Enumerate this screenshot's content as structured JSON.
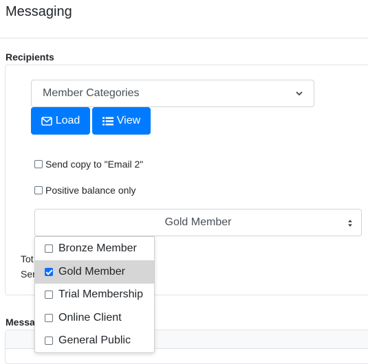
{
  "page": {
    "title": "Messaging"
  },
  "recipients": {
    "label": "Recipients",
    "category_select": {
      "value": "Member Categories"
    },
    "load_button": {
      "label": "Load",
      "icon": "envelope-icon"
    },
    "view_button": {
      "label": "View",
      "icon": "list-icon"
    },
    "send_copy": {
      "label": "Send copy to \"Email 2\"",
      "checked": false
    },
    "positive_balance": {
      "label": "Positive balance only",
      "checked": false
    },
    "member_select": {
      "value": "Gold Member"
    },
    "partial_total": "Tot",
    "partial_sent": "Sen"
  },
  "dropdown": {
    "options": [
      {
        "label": "Bronze Member",
        "checked": false
      },
      {
        "label": "Gold Member",
        "checked": true
      },
      {
        "label": "Trial Membership",
        "checked": false
      },
      {
        "label": "Online Client",
        "checked": false
      },
      {
        "label": "General Public",
        "checked": false
      }
    ]
  },
  "message": {
    "label": "Messa"
  },
  "colors": {
    "primary": "#007bff",
    "border": "#dee2e6",
    "highlight": "#d6d6d6"
  }
}
